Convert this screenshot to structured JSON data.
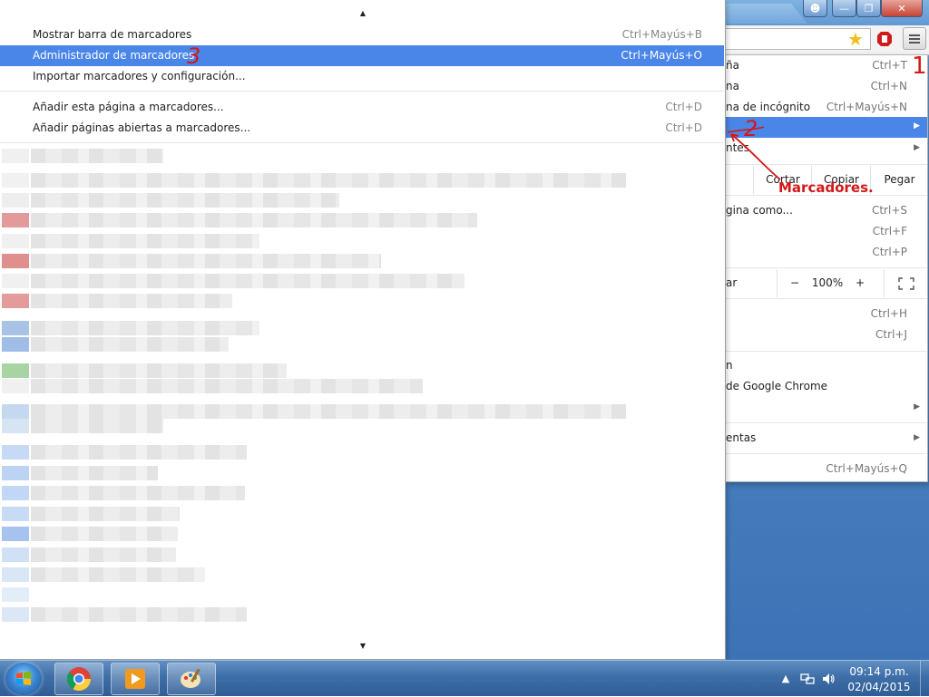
{
  "bookmarks_menu": {
    "items_top": [
      {
        "label": "Mostrar barra de marcadores",
        "shortcut": "Ctrl+Mayús+B"
      },
      {
        "label": "Administrador de marcadores",
        "shortcut": "Ctrl+Mayús+O"
      },
      {
        "label": "Importar marcadores y configuración...",
        "shortcut": ""
      }
    ],
    "items_add": [
      {
        "label": "Añadir esta página a marcadores...",
        "shortcut": "Ctrl+D"
      },
      {
        "label": "Añadir páginas abiertas a marcadores...",
        "shortcut": "Ctrl+D"
      }
    ]
  },
  "chrome_menu": {
    "items": [
      {
        "label": "ña",
        "shortcut": "Ctrl+T"
      },
      {
        "label": "na",
        "shortcut": "Ctrl+N"
      },
      {
        "label": "na de incógnito",
        "shortcut": "Ctrl+Mayús+N"
      }
    ],
    "tools_partial": "ntes",
    "edit": {
      "cut": "Cortar",
      "copy": "Copiar",
      "paste": "Pegar"
    },
    "save_items": [
      {
        "label": "gina como...",
        "shortcut": "Ctrl+S"
      },
      {
        "label": "",
        "shortcut": "Ctrl+F"
      },
      {
        "label": "",
        "shortcut": "Ctrl+P"
      }
    ],
    "zoom": {
      "label": "ar",
      "minus": "−",
      "value": "100%",
      "plus": "+"
    },
    "history_items": [
      {
        "label": "",
        "shortcut": "Ctrl+H"
      },
      {
        "label": "",
        "shortcut": "Ctrl+J"
      }
    ],
    "signin_partial": "n",
    "about_partial": "de Google Chrome",
    "settings_partial": "entas",
    "exit_shortcut": "Ctrl+Mayús+Q"
  },
  "annotations": {
    "step1": "1",
    "step2": "2",
    "step3": "3",
    "marcadores": "Marcadores."
  },
  "taskbar": {
    "time": "09:14 p.m.",
    "date": "02/04/2015"
  },
  "colors": {
    "highlight": "#4a86e8",
    "annotation": "#d3181a"
  }
}
